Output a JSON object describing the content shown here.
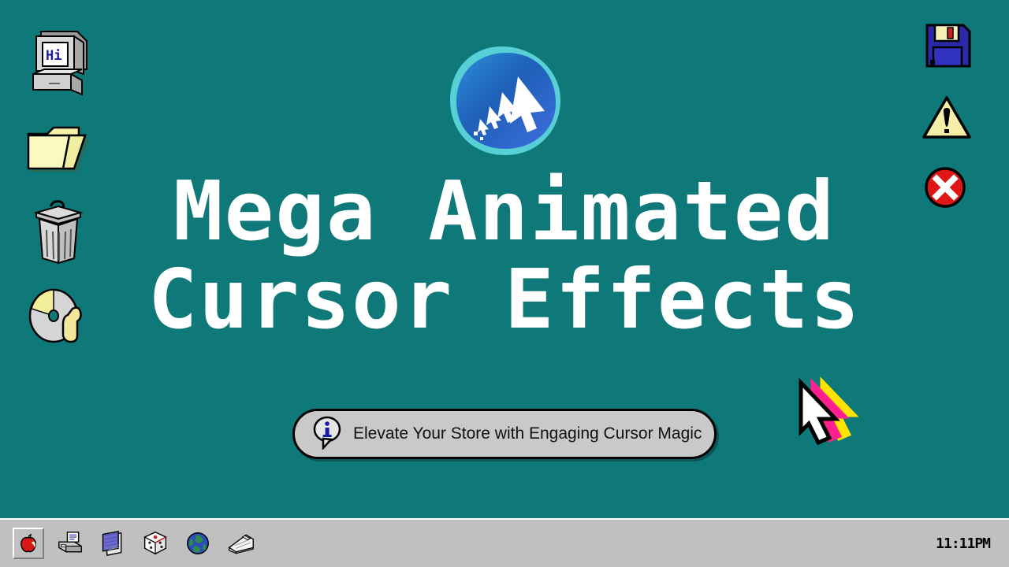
{
  "desktop": {
    "background_color": "#0f7878",
    "style": "retro-windows-95"
  },
  "logo": {
    "name": "animated-cursor-logo",
    "gradient_from": "#4ed8d8",
    "gradient_to": "#2a5fc8",
    "glyph": "cursor-arrow-trail"
  },
  "title": {
    "line1": "Mega Animated",
    "line2": "Cursor Effects",
    "color": "#ffffff"
  },
  "subtitle": {
    "icon": "info-bubble-icon",
    "text": "Elevate Your Store with Engaging Cursor Magic",
    "background_color": "#c9c9c9"
  },
  "left_icons": [
    {
      "name": "my-computer-icon",
      "label": "Hi"
    },
    {
      "name": "folder-icon",
      "label": ""
    },
    {
      "name": "trash-can-icon",
      "label": ""
    },
    {
      "name": "cd-disc-icon",
      "label": ""
    }
  ],
  "right_icons": [
    {
      "name": "floppy-disk-icon",
      "label": ""
    },
    {
      "name": "warning-triangle-icon",
      "label": ""
    },
    {
      "name": "error-stop-icon",
      "label": ""
    }
  ],
  "cursor_graphic": {
    "name": "pixel-cursor-arrow",
    "colors": {
      "primary": "#ffffff",
      "trail_magenta": "#ff1f8f",
      "trail_yellow": "#ffe400"
    }
  },
  "taskbar": {
    "background_color": "#c0c0c0",
    "items": [
      {
        "name": "taskbar-apple-icon",
        "label": "Apple"
      },
      {
        "name": "taskbar-printer-icon",
        "label": "Printer"
      },
      {
        "name": "taskbar-notepad-icon",
        "label": "Notepad"
      },
      {
        "name": "taskbar-dice-icon",
        "label": "Dice"
      },
      {
        "name": "taskbar-globe-icon",
        "label": "Internet"
      },
      {
        "name": "taskbar-cardfile-icon",
        "label": "Cardfile"
      }
    ],
    "clock": "11:11PM"
  }
}
